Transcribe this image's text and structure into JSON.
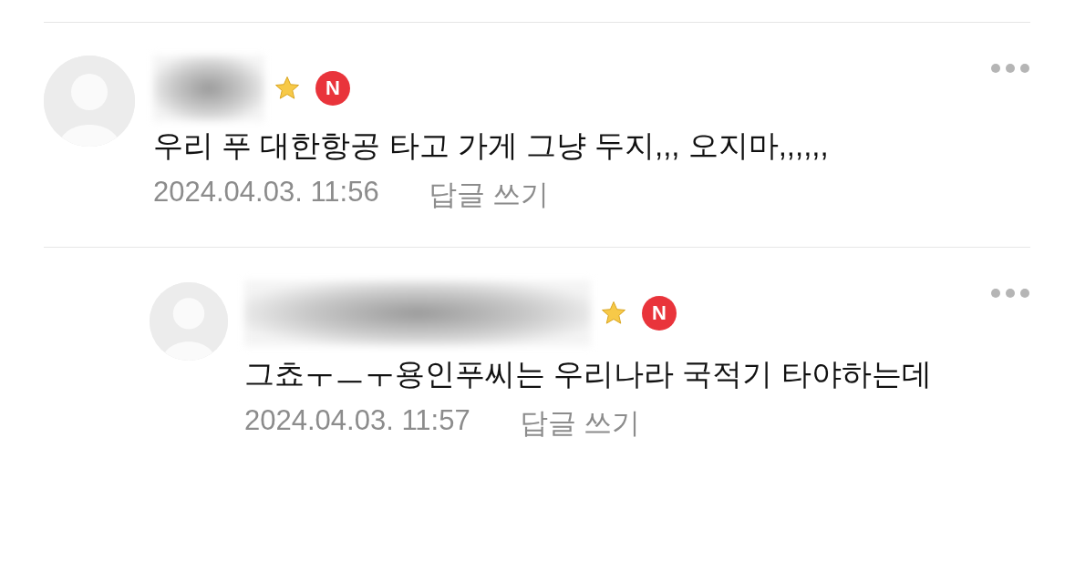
{
  "comments": [
    {
      "kind": "comment",
      "badge": "N",
      "text": "우리 푸 대한항공 타고 가게 그냥 두지,,, 오지마,,,,,,",
      "date": "2024.04.03. 11:56",
      "reply_label": "답글 쓰기"
    },
    {
      "kind": "reply",
      "badge": "N",
      "text": "그쵸ㅜㅡㅜ용인푸씨는 우리나라 국적기 타야하는데",
      "date": "2024.04.03. 11:57",
      "reply_label": "답글 쓰기"
    }
  ]
}
